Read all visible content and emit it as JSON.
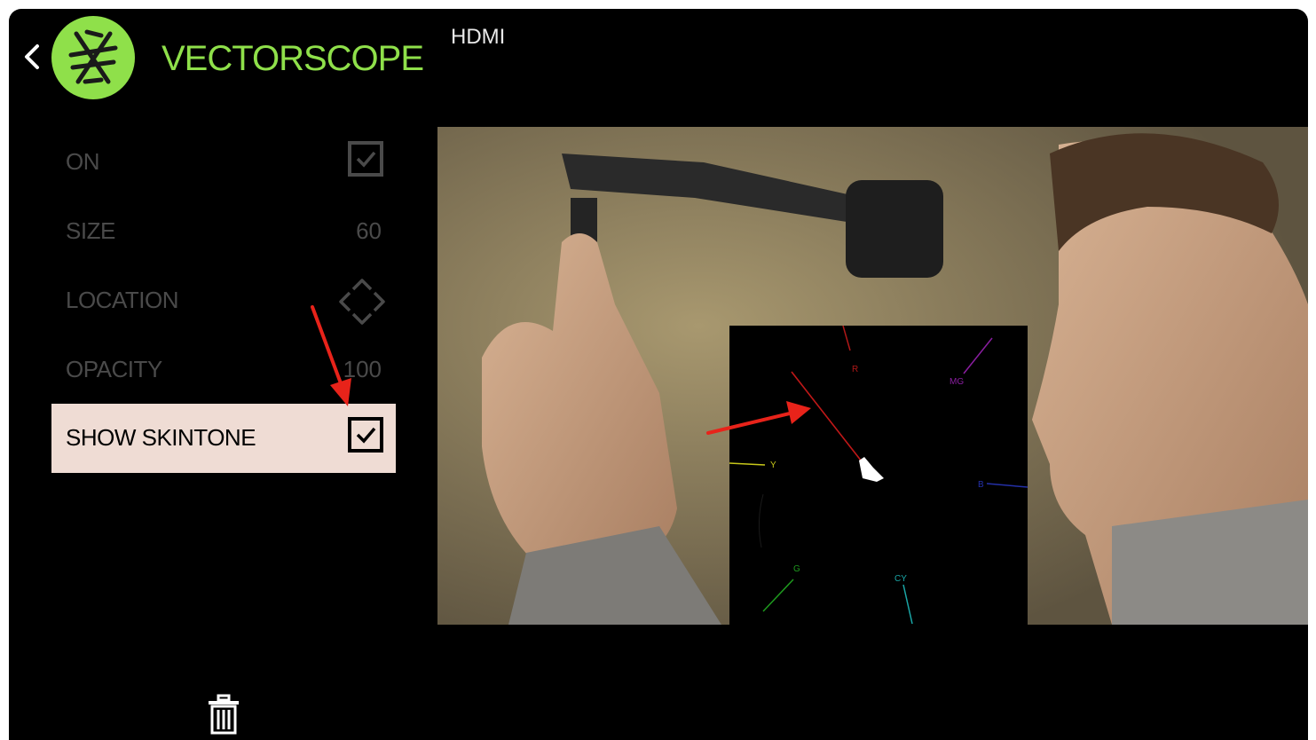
{
  "header": {
    "title": "VECTORSCOPE",
    "source": "HDMI"
  },
  "menu": {
    "on": {
      "label": "ON",
      "checked": true
    },
    "size": {
      "label": "SIZE",
      "value": "60"
    },
    "location": {
      "label": "LOCATION"
    },
    "opacity": {
      "label": "OPACITY",
      "value": "100"
    },
    "show_skintone": {
      "label": "SHOW SKINTONE",
      "checked": true
    }
  },
  "scope": {
    "labels": {
      "red": "R",
      "magenta": "MG",
      "yellow": "Y",
      "blue": "B",
      "green": "G",
      "cyan": "CY"
    }
  },
  "colors": {
    "accent": "#8fe04a",
    "highlight": "#efdcd4",
    "annotation": "#e8231a",
    "muted_text": "#4a4a4a"
  },
  "icons": {
    "back": "chevron-left-icon",
    "logo": "app-logo-icon",
    "location": "four-direction-arrows-icon",
    "trash": "trash-icon",
    "checkbox": "checkmark-icon"
  }
}
